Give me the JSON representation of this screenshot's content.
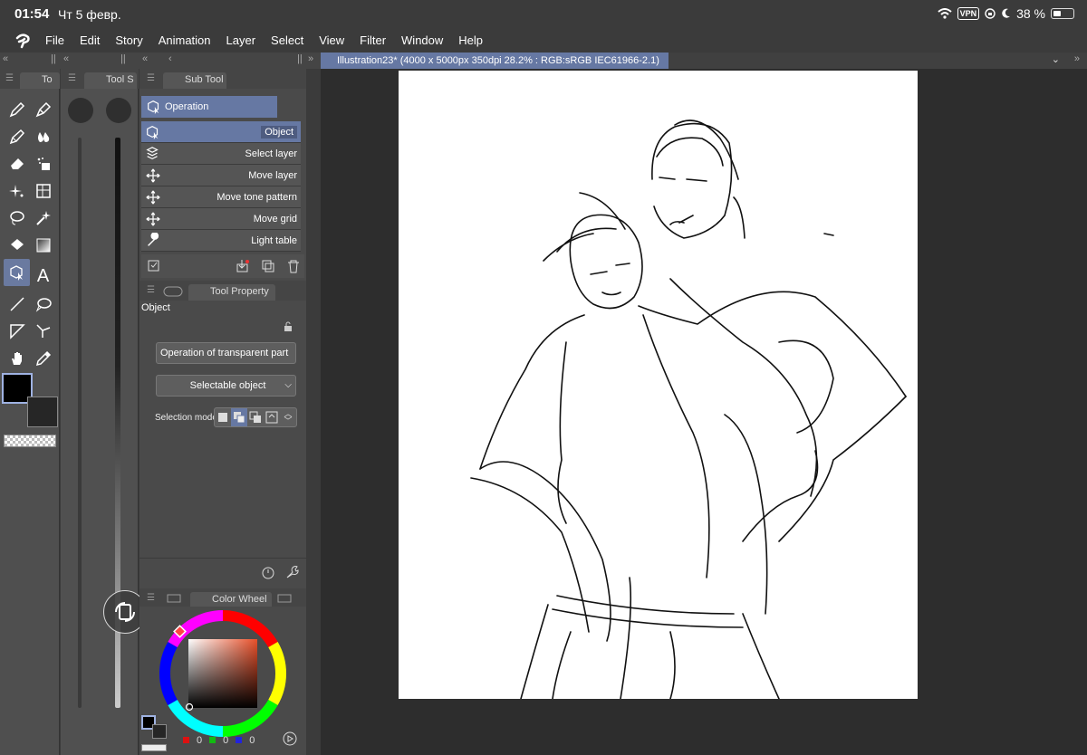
{
  "status": {
    "time": "01:54",
    "date": "Чт 5 февр.",
    "vpn": "VPN",
    "battery": "38 %"
  },
  "menu": {
    "items": [
      "File",
      "Edit",
      "Story",
      "Animation",
      "Layer",
      "Select",
      "View",
      "Filter",
      "Window",
      "Help"
    ]
  },
  "panels": {
    "tool_tab": "To",
    "tool_size_tab": "Tool S",
    "sub_tool_tab": "Sub Tool",
    "tool_property_tab": "Tool Property",
    "color_wheel_tab": "Color Wheel"
  },
  "subtool": {
    "group": "Operation",
    "items": [
      "Object",
      "Select layer",
      "Move layer",
      "Move tone pattern",
      "Move grid",
      "Light table"
    ],
    "selected": "Object"
  },
  "tool_property": {
    "title": "Object",
    "transparent_select": "Operation of transparent part",
    "selectable_select": "Selectable object",
    "selection_mode_label": "Selection mode"
  },
  "color": {
    "r": "0",
    "g": "0",
    "b": "0",
    "fg": "#000000",
    "bg": "#262626"
  },
  "document": {
    "title": "Illustration23* (4000 x 5000px 350dpi 28.2% : RGB:sRGB IEC61966-2.1)"
  },
  "accent": "#6678a3"
}
